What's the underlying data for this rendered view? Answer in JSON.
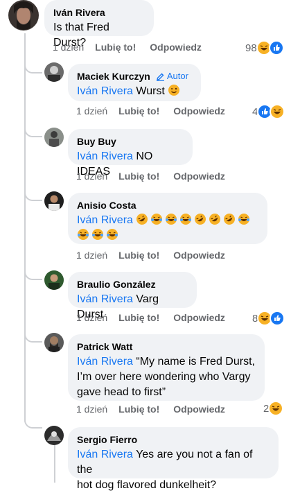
{
  "actions": {
    "like": "Lubię to!",
    "reply": "Odpowiedz"
  },
  "root": {
    "author": "Iván Rivera",
    "text": "Is that Fred Durst?",
    "time": "1 dzień",
    "reaction_count": "98"
  },
  "replies": [
    {
      "author": "Maciek Kurczyn",
      "badge": "Autor",
      "tag": "Iván Rivera",
      "text": "Wurst",
      "time": "1 dzień",
      "reaction_count": "4"
    },
    {
      "author": "Buy Buy",
      "tag": "Iván Rivera",
      "text": "NO IDEAS",
      "time": "1 dzień"
    },
    {
      "author": "Anisio Costa",
      "tag": "Iván Rivera",
      "emoji_line1": [
        "rofl",
        "joy",
        "joy",
        "joy",
        "rofl",
        "rofl",
        "rofl",
        "joy"
      ],
      "emoji_line2": [
        "joy",
        "joy",
        "joy"
      ],
      "time": "1 dzień"
    },
    {
      "author": "Braulio González",
      "tag": "Iván Rivera",
      "text": "Varg Durst",
      "time": "1 dzień",
      "reaction_count": "8"
    },
    {
      "author": "Patrick Watt",
      "tag": "Iván Rivera",
      "text_line1": "“My name is Fred Durst,",
      "text_line2": "I’m over here wondering who Vargy",
      "text_line3": "gave head to first”",
      "time": "1 dzień",
      "reaction_count": "2"
    },
    {
      "author": "Sergio Fierro",
      "tag": "Iván Rivera",
      "text_line1": "Yes are you not a fan of the",
      "text_line2": "hot dog flavored dunkelheit?"
    }
  ],
  "icons": {
    "haha": "haha-emoji-icon",
    "like": "like-reaction-icon",
    "pencil": "pencil-icon"
  },
  "colors": {
    "link": "#1877f2",
    "bubble": "#f0f2f5",
    "meta": "#65676b"
  }
}
